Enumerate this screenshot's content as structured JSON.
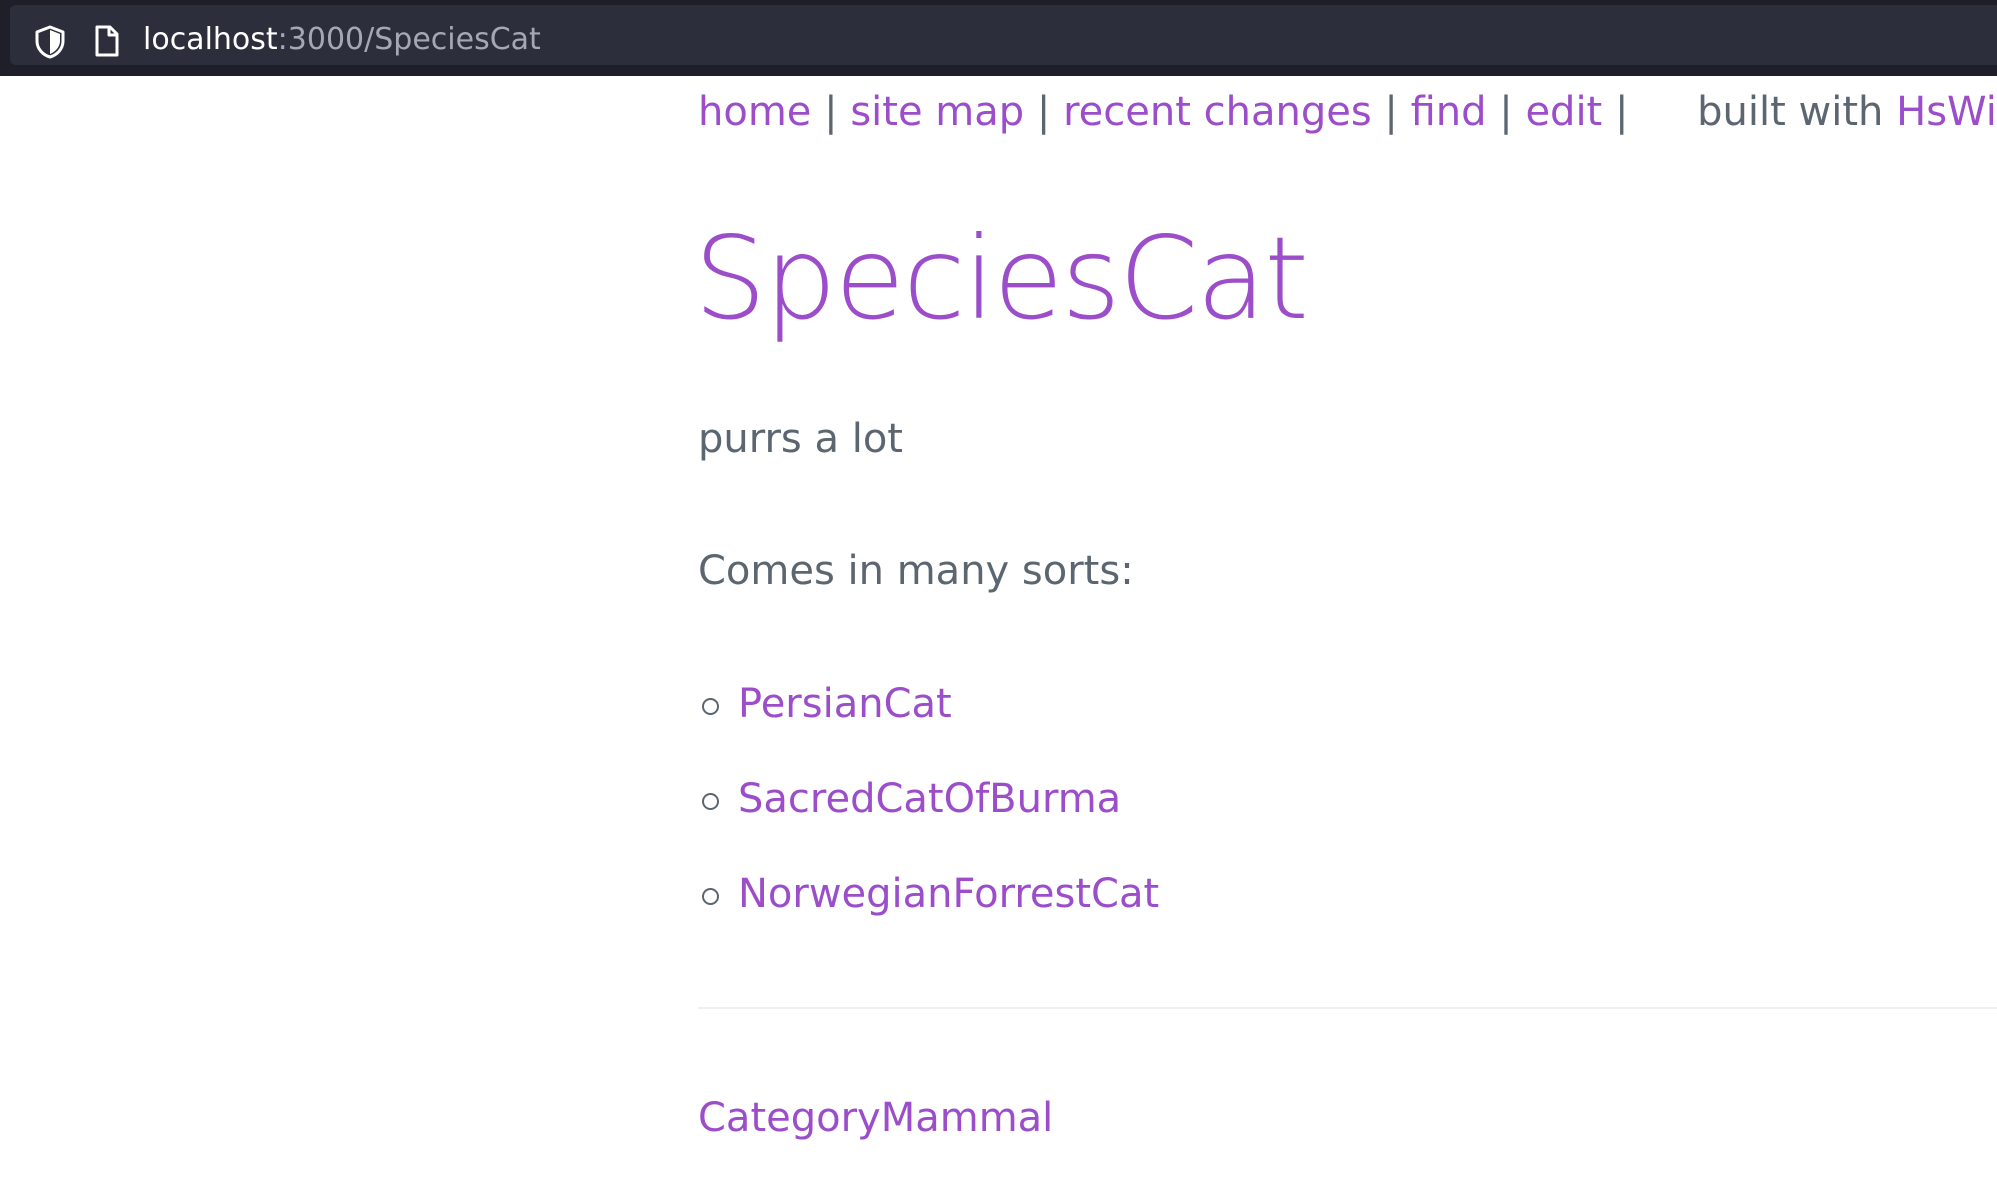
{
  "browser": {
    "url_host": "localhost",
    "url_path": ":3000/SpeciesCat",
    "icons": [
      "shield-icon",
      "page-icon"
    ]
  },
  "nav": {
    "home": "home",
    "site_map": "site map",
    "recent_changes": "recent changes",
    "find": "find",
    "edit": "edit",
    "separator": "|",
    "built_with": "built with",
    "hswiki": "HsWiki"
  },
  "page": {
    "title": "SpeciesCat",
    "description": "purrs a lot",
    "intro": "Comes in many sorts:",
    "sorts": [
      "PersianCat",
      "SacredCatOfBurma",
      "NorwegianForrestCat"
    ],
    "category": "CategoryMammal"
  },
  "colors": {
    "link": "#9b4dca",
    "text": "#5c6670",
    "browser_bar": "#1e1f29",
    "url_field": "#2c2f3b"
  }
}
